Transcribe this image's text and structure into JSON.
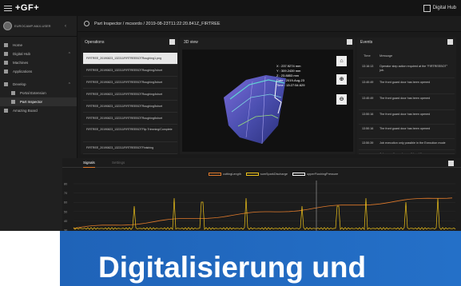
{
  "app": {
    "logo": "+GF+",
    "hub_label": "Digital Hub"
  },
  "breadcrumb": "Part Inspector / mcsordo / 2019-08-23T11:22:20.841Z_FIRTREE",
  "sidebar": {
    "user": "EUROCAMP-MAX-USER",
    "items": [
      {
        "label": "Home",
        "icon": "home-icon",
        "level": 0
      },
      {
        "label": "Digital Hub",
        "icon": "grid-icon",
        "level": 0
      },
      {
        "label": "Machines",
        "icon": "machine-icon",
        "level": 1
      },
      {
        "label": "Applications",
        "icon": "apps-icon",
        "level": 1
      },
      {
        "label": "Develop",
        "icon": "wrench-icon",
        "level": 0
      },
      {
        "label": "Portal Extension",
        "icon": "extension-icon",
        "level": 1
      },
      {
        "label": "Part Inspector",
        "icon": "search-icon",
        "level": 1,
        "active": true
      },
      {
        "label": "Amazing Board",
        "icon": "board-icon",
        "level": 0
      }
    ]
  },
  "operations": {
    "title": "Operations",
    "rows": [
      "FIRTREE_20190823_132311FIRTREEBOTRoughing1.png",
      "FIRTREE_20190823_132311FIRTREEBOTRoughing2short",
      "FIRTREE_20190823_132311FIRTREEBOTRoughing3short",
      "FIRTREE_20190823_132311FIRTREEBOTRoughing4short",
      "FIRTREE_20190823_132311FIRTREEBOTRoughing5short",
      "FIRTREE_20190823_132311FIRTREEBOTRoughing6short",
      "FIRTREE_20190823_132311FIRTREEBOTFlip Trimming/Complete",
      "FIRTREE_20190823_132311FIRTREEBOTFinishing"
    ]
  },
  "view3d": {
    "title": "3D view",
    "readout": [
      "X : 237.9274 mm",
      "Y : 309.2439 mm",
      "Z : 23.8853 mm",
      "Date : 2019-Aug-23",
      "Time : 13:27:54.629"
    ],
    "buttons": [
      "⌂",
      "⊕",
      "⊖"
    ]
  },
  "events": {
    "title": "Events",
    "col_time": "Time",
    "col_message": "Message",
    "rows": [
      {
        "time": "13:16:13",
        "message": "Operator step action required at the \"FIRTREEBOT\" job."
      },
      {
        "time": "13:40:49",
        "message": "The front guard door has been opened"
      },
      {
        "time": "13:40:49",
        "message": "The front guard door has been opened"
      },
      {
        "time": "13:50:16",
        "message": "The front guard door has been opened"
      },
      {
        "time": "13:50:16",
        "message": "The front guard door has been opened"
      },
      {
        "time": "13:50:39",
        "message": "Job execution only possible in the Execution mode"
      },
      {
        "time": "",
        "message": "Job execution only possible while see"
      }
    ]
  },
  "signals": {
    "tabs": [
      "Signals",
      "Settings"
    ],
    "legend": [
      {
        "name": "cuttingLength",
        "color": "#e07a2b"
      },
      {
        "name": "sumSparkDischarge",
        "color": "#f0c419"
      },
      {
        "name": "upperFlushingPressure",
        "color": "#ffffff"
      }
    ],
    "y_ticks": [
      "80",
      "70",
      "60",
      "50",
      "40",
      "30"
    ]
  },
  "chart_data": {
    "type": "line",
    "x": [],
    "series": [
      {
        "name": "cuttingLength",
        "values": []
      },
      {
        "name": "sumSparkDischarge",
        "values": []
      },
      {
        "name": "upperFlushingPressure",
        "values": []
      }
    ],
    "ylim": [
      25,
      85
    ]
  },
  "banner": {
    "text": "Digitalisierung und"
  },
  "colors": {
    "accent": "#e07a2b",
    "spark": "#f0c419",
    "banner": "#1f63b8"
  }
}
